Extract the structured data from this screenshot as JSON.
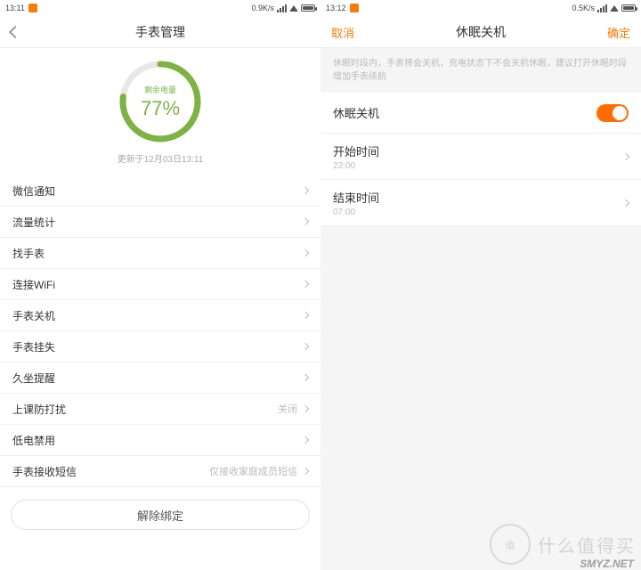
{
  "left": {
    "status": {
      "time": "13:11",
      "net": "0.9K/s"
    },
    "title": "手表管理",
    "battery": {
      "label": "剩余电量",
      "percent_text": "77%",
      "percent": 77
    },
    "updated": "更新于12月03日13:11",
    "rows": [
      {
        "label": "微信通知",
        "sub": ""
      },
      {
        "label": "流量统计",
        "sub": ""
      },
      {
        "label": "找手表",
        "sub": ""
      },
      {
        "label": "连接WiFi",
        "sub": ""
      },
      {
        "label": "手表关机",
        "sub": ""
      },
      {
        "label": "手表挂失",
        "sub": ""
      },
      {
        "label": "久坐提醒",
        "sub": ""
      },
      {
        "label": "上课防打扰",
        "sub": "关闭"
      },
      {
        "label": "低电禁用",
        "sub": ""
      },
      {
        "label": "手表接收短信",
        "sub": "仅接收家庭成员短信"
      }
    ],
    "unbind": "解除绑定"
  },
  "right": {
    "status": {
      "time": "13:12",
      "net": "0.5K/s"
    },
    "cancel": "取消",
    "confirm": "确定",
    "title": "休眠关机",
    "hint": "休眠时段内，手表将会关机，充电状态下不会关机休眠，建议打开休眠时段增加手表续航",
    "toggle_label": "休眠关机",
    "start": {
      "label": "开始时间",
      "value": "22:00"
    },
    "end": {
      "label": "结束时间",
      "value": "07:00"
    }
  },
  "watermark": {
    "badge": "值",
    "text": "什么值得买",
    "site": "SMYZ.NET"
  }
}
